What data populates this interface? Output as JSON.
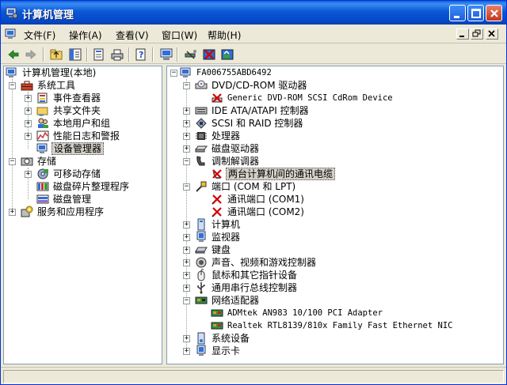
{
  "window": {
    "title": "计算机管理"
  },
  "menu": {
    "items": [
      "文件(F)",
      "操作(A)",
      "查看(V)",
      "窗口(W)",
      "帮助(H)"
    ]
  },
  "toolbar": {
    "buttons": [
      "back-arrow-icon",
      "forward-arrow-icon",
      "up-folder-icon",
      "show-hide-tree-icon",
      "properties-icon",
      "print-icon",
      "help-icon",
      "computer-icon",
      "scan-hardware-icon",
      "uninstall-icon",
      "update-driver-icon"
    ]
  },
  "left_tree": {
    "root": "计算机管理(本地)",
    "system_tools": "系统工具",
    "event_viewer": "事件查看器",
    "shared_folders": "共享文件夹",
    "local_users": "本地用户和组",
    "perf_logs": "性能日志和警报",
    "device_manager": "设备管理器",
    "storage": "存储",
    "removable_storage": "可移动存储",
    "defrag": "磁盘碎片整理程序",
    "disk_mgmt": "磁盘管理",
    "services": "服务和应用程序"
  },
  "right_tree": {
    "computer": "FA006755ABD6492",
    "dvd": "DVD/CD-ROM 驱动器",
    "dvd_device": "Generic DVD-ROM SCSI CdRom Device",
    "ide": "IDE ATA/ATAPI 控制器",
    "scsi": "SCSI 和 RAID 控制器",
    "cpu": "处理器",
    "disk": "磁盘驱动器",
    "modem": "调制解调器",
    "modem_device": "两台计算机间的通讯电缆",
    "ports": "端口 (COM 和 LPT)",
    "com1": "通讯端口 (COM1)",
    "com2": "通讯端口 (COM2)",
    "computer_cat": "计算机",
    "monitor": "监视器",
    "keyboard": "键盘",
    "sound": "声音、视频和游戏控制器",
    "mouse": "鼠标和其它指针设备",
    "usb": "通用串行总线控制器",
    "net": "网络适配器",
    "nic1": "ADMtek AN983 10/100 PCI Adapter",
    "nic2": "Realtek RTL8139/810x Family Fast Ethernet NIC",
    "sysdev": "系统设备",
    "display": "显示卡"
  },
  "colors": {
    "titlebar": "#0a58d6",
    "selection": "#d4d0c8",
    "error": "#d40000"
  }
}
